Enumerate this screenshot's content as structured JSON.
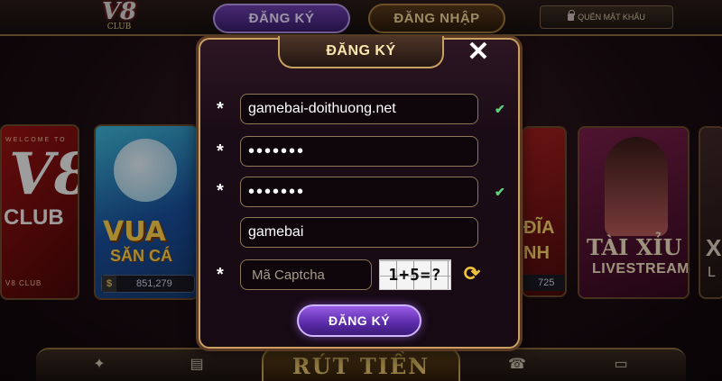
{
  "header": {
    "logo_main": "V8",
    "logo_sub": "CLUB",
    "tab_register": "ĐĂNG KÝ",
    "tab_login": "ĐĂNG NHẬP",
    "forgot_password": "QUÊN MẬT KHẨU"
  },
  "games": {
    "v8_card": {
      "welcome": "WELCOME TO",
      "big": "V8",
      "club": "CLUB",
      "footer": "V8 CLUB"
    },
    "vua_san_ca": {
      "line1": "VUA",
      "line2": "SĂN CÁ",
      "jackpot": "851,279",
      "currency": "$"
    },
    "dia": {
      "line1": "ĐĨA",
      "line2": "NH",
      "jackpot": "725"
    },
    "tai_xiu": {
      "title": "TÀI XỈU",
      "sub": "LIVESTREAM"
    },
    "xo": {
      "title": "X",
      "sub": "L"
    }
  },
  "bottom": {
    "center_label": "RÚT TIỀN"
  },
  "dialog": {
    "title": "ĐĂNG KÝ",
    "close": "✕",
    "required_mark": "*",
    "username_value": "gamebai-doithuong.net",
    "password_value": "•••••••",
    "confirm_password_value": "•••••••",
    "display_name_value": "gamebai",
    "captcha_placeholder": "Mã Captcha",
    "captcha_image_text": "1+5=?",
    "submit_label": "ĐĂNG KÝ",
    "valid_mark": "✔"
  },
  "colors": {
    "accent_purple": "#6e3fae",
    "gold_border": "#c8a062",
    "check_green": "#5fd17a",
    "refresh_yellow": "#f0c23a"
  }
}
